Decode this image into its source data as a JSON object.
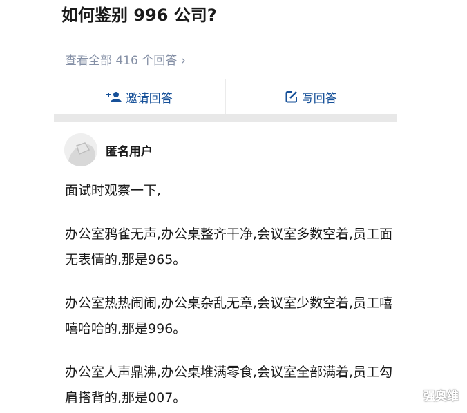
{
  "question": {
    "title": "如何鉴别 996 公司?",
    "view_all_label": "查看全部 416 个回答",
    "chevron": "›"
  },
  "actions": {
    "invite_label": "邀请回答",
    "write_label": "写回答",
    "invite_icon": "add-user-icon",
    "write_icon": "edit-icon"
  },
  "answer": {
    "author": "匿名用户",
    "paragraphs": [
      "面试时观察一下,",
      "办公室鸦雀无声,办公桌整齐干净,会议室多数空着,员工面无表情的,那是965。",
      "办公室热热闹闹,办公桌杂乱无章,会议室少数空着,员工嘻嘻哈哈的,那是996。",
      "办公室人声鼎沸,办公桌堆满零食,会议室全部满着,员工勾肩搭背的,那是007。"
    ]
  },
  "watermark": "强奥维",
  "colors": {
    "accent": "#175199",
    "muted": "#8590a6",
    "divider": "#e8e8e8"
  }
}
